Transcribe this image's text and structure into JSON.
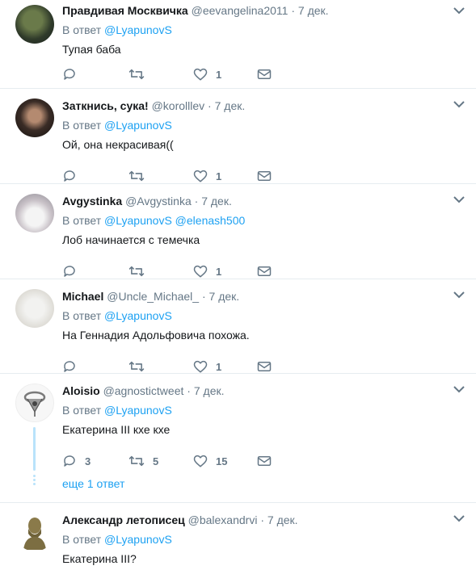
{
  "tweets": [
    {
      "name": "Правдивая Москвичка",
      "handle": "@eevangelina2011",
      "sep": "·",
      "time": "7 дек.",
      "reply_prefix": "В ответ",
      "mentions": [
        "@LyapunovS"
      ],
      "text": "Тупая баба",
      "counts": {
        "replies": "",
        "retweets": "",
        "likes": "1"
      }
    },
    {
      "name": "Заткнись, сука!",
      "handle": "@korolllev",
      "sep": "·",
      "time": "7 дек.",
      "reply_prefix": "В ответ",
      "mentions": [
        "@LyapunovS"
      ],
      "text": "Ой, она некрасивая((",
      "counts": {
        "replies": "",
        "retweets": "",
        "likes": "1"
      }
    },
    {
      "name": "Avgystinka",
      "handle": "@Avgystinka",
      "sep": "·",
      "time": "7 дек.",
      "reply_prefix": "В ответ",
      "mentions": [
        "@LyapunovS",
        "@elenash500"
      ],
      "text": "Лоб начинается с темечка",
      "counts": {
        "replies": "",
        "retweets": "",
        "likes": "1"
      }
    },
    {
      "name": "Michael",
      "handle": "@Uncle_Michael_",
      "sep": "·",
      "time": "7 дек.",
      "reply_prefix": "В ответ",
      "mentions": [
        "@LyapunovS"
      ],
      "text": "На Геннадия Адольфовича похожа.",
      "counts": {
        "replies": "",
        "retweets": "",
        "likes": "1"
      }
    },
    {
      "name": "Aloisio",
      "handle": "@agnostictweet",
      "sep": "·",
      "time": "7 дек.",
      "reply_prefix": "В ответ",
      "mentions": [
        "@LyapunovS"
      ],
      "text": "Екатерина III кхе кхе",
      "counts": {
        "replies": "3",
        "retweets": "5",
        "likes": "15"
      },
      "more_replies": "еще 1 ответ"
    },
    {
      "name": "Александр летописец",
      "handle": "@balexandrvi",
      "sep": "·",
      "time": "7 дек.",
      "reply_prefix": "В ответ",
      "mentions": [
        "@LyapunovS"
      ],
      "text": "Екатерина III?"
    }
  ],
  "colors": {
    "accent": "#1da1f2",
    "muted": "#657786",
    "text": "#14171a",
    "divider": "#e6ecf0"
  },
  "icons": {
    "reply": "reply-icon",
    "retweet": "retweet-icon",
    "like": "heart-icon",
    "dm": "envelope-icon",
    "caret": "chevron-down-icon"
  }
}
